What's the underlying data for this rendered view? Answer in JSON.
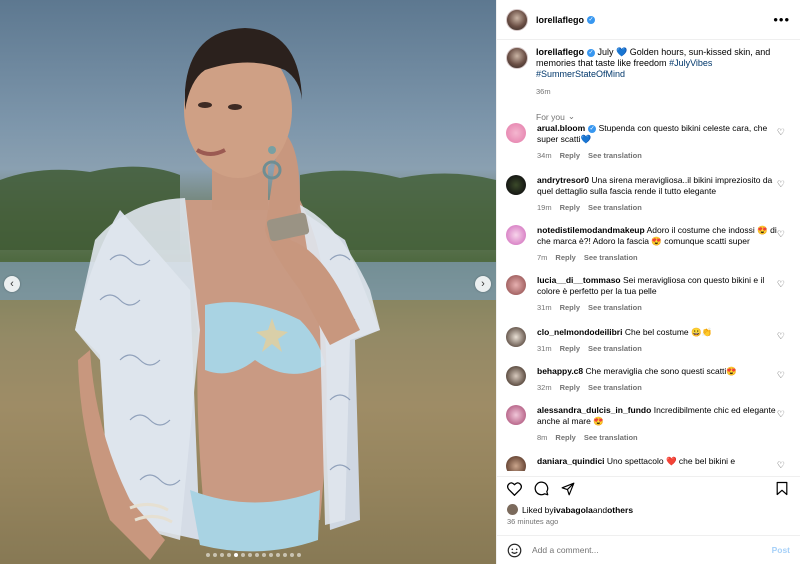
{
  "post": {
    "username": "lorellaflego",
    "caption_user": "lorellaflego",
    "caption_text": " July 💙 Golden hours, sun-kissed skin, and memories that taste like freedom ",
    "caption_tag1": "#JulyVibes",
    "caption_tag2": "#SummerStateOfMind",
    "caption_time": "36m",
    "for_you_label": "For you",
    "more_label": "•••"
  },
  "comments": [
    {
      "user": "arual.bloom",
      "verified": true,
      "text": "Stupenda con questo bikini celeste cara, che super scatti💙",
      "time": "34m",
      "reply": "Reply",
      "translate": "See translation"
    },
    {
      "user": "andrytresor0",
      "verified": false,
      "text": "Una sirena meravigliosa..il bikini impreziosito da quel dettaglio sulla fascia rende il tutto elegante",
      "time": "19m",
      "reply": "Reply",
      "translate": "See translation"
    },
    {
      "user": "notedistilemodandmakeup",
      "verified": false,
      "text": "Adoro il costume che indossi 😍 di che marca è?! Adoro la fascia 😍 comunque scatti super",
      "time": "7m",
      "reply": "Reply",
      "translate": "See translation"
    },
    {
      "user": "lucia__di__tommaso",
      "verified": false,
      "text": "Sei meravigliosa con questo bikini e il colore è perfetto per la tua pelle",
      "time": "31m",
      "reply": "Reply",
      "translate": "See translation"
    },
    {
      "user": "clo_nelmondodeilibri",
      "verified": false,
      "text": "Che bel costume 😀👏",
      "time": "31m",
      "reply": "Reply",
      "translate": "See translation"
    },
    {
      "user": "behappy.c8",
      "verified": false,
      "text": "Che meraviglia che sono questi scatti😍",
      "time": "32m",
      "reply": "Reply",
      "translate": "See translation"
    },
    {
      "user": "alessandra_dulcis_in_fundo",
      "verified": false,
      "text": "Incredibilmente chic ed elegante anche al mare 😍",
      "time": "8m",
      "reply": "Reply",
      "translate": "See translation"
    },
    {
      "user": "daniara_quindici",
      "verified": false,
      "text": "Uno spettacolo ❤️ che bel bikini e",
      "time": "",
      "reply": "",
      "translate": ""
    }
  ],
  "likes": {
    "prefix": "Liked by ",
    "user": "ivabagola",
    "and": " and ",
    "others": "others",
    "posted": "36 minutes ago"
  },
  "composer": {
    "placeholder": "Add a comment...",
    "post_label": "Post"
  },
  "carousel": {
    "total_slides": 14,
    "active_index": 4
  }
}
